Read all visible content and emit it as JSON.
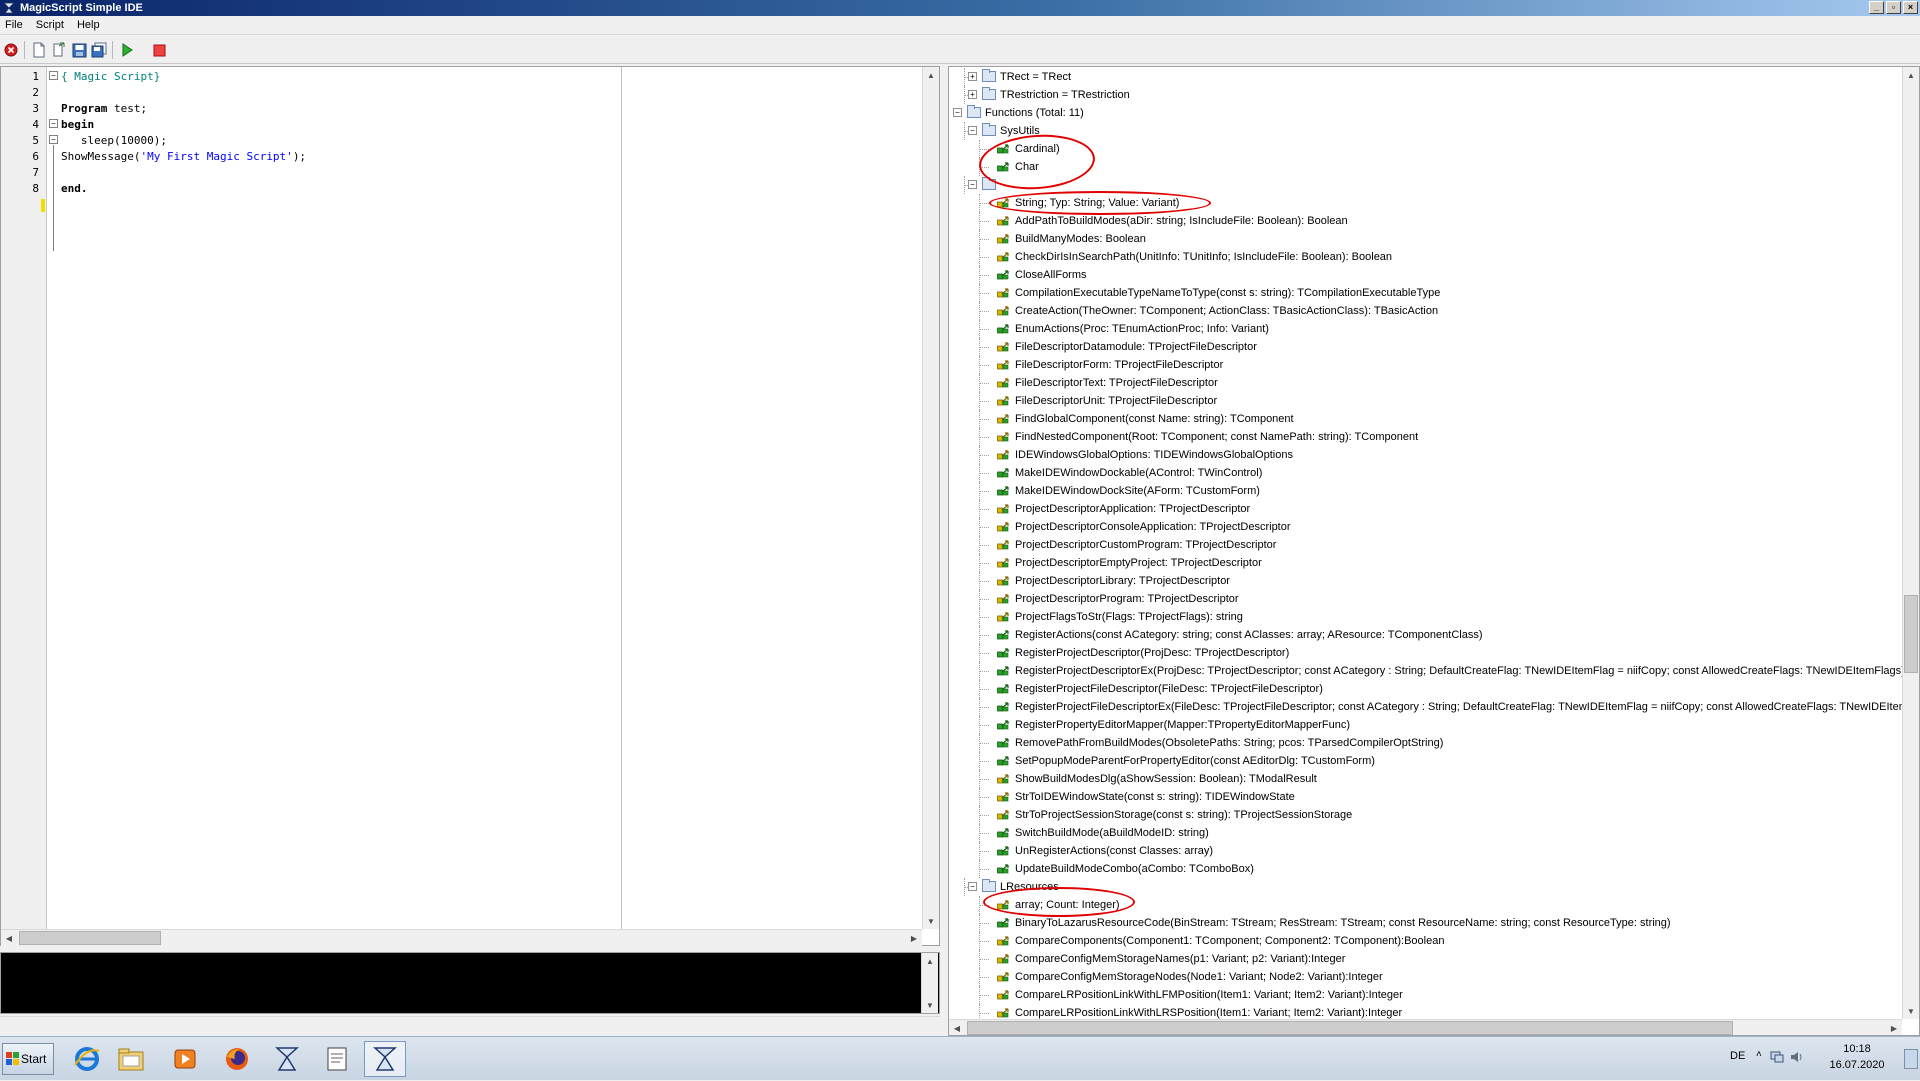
{
  "window": {
    "title": "MagicScript Simple IDE"
  },
  "menu": [
    "File",
    "Script",
    "Help"
  ],
  "toolbar": {
    "icons": [
      "stop-circle-icon",
      "new-file-icon",
      "open-file-icon",
      "save-icon",
      "save-all-icon",
      "run-icon",
      "stop-icon"
    ]
  },
  "editor": {
    "line_numbers": [
      "1",
      "2",
      "3",
      "4",
      "5",
      "6",
      "7",
      "8"
    ],
    "lines": [
      {
        "parts": [
          {
            "t": "{ Magic Script}",
            "c": "cm"
          }
        ]
      },
      {
        "parts": []
      },
      {
        "parts": [
          {
            "t": "Program",
            "c": "kw"
          },
          {
            "t": " test;",
            "c": ""
          }
        ]
      },
      {
        "parts": [
          {
            "t": "begin",
            "c": "kw"
          }
        ]
      },
      {
        "parts": [
          {
            "t": "   sleep(10000);",
            "c": ""
          }
        ]
      },
      {
        "parts": [
          {
            "t": "ShowMessage(",
            "c": ""
          },
          {
            "t": "'My First Magic Script'",
            "c": "str"
          },
          {
            "t": ");",
            "c": ""
          }
        ]
      },
      {
        "parts": []
      },
      {
        "parts": [
          {
            "t": "end.",
            "c": "kw"
          }
        ]
      }
    ]
  },
  "tree": {
    "rows": [
      {
        "level": 1,
        "exp": "+",
        "icon": "folder",
        "text": "TRect = TRect"
      },
      {
        "level": 1,
        "exp": "+",
        "icon": "folder",
        "text": "TRestriction = TRestriction"
      },
      {
        "level": 0,
        "exp": "-",
        "icon": "folder",
        "text": "Functions (Total: 11)"
      },
      {
        "level": 1,
        "exp": "-",
        "icon": "folder",
        "text": "SysUtils"
      },
      {
        "level": 2,
        "icon": "green",
        "text": "Cardinal)"
      },
      {
        "level": 2,
        "icon": "green",
        "text": "Char"
      },
      {
        "level": 1,
        "exp": "-",
        "icon": "folder",
        "text": ""
      },
      {
        "level": 2,
        "icon": "yellow",
        "text": "String; Typ: String; Value: Variant)"
      },
      {
        "level": 2,
        "icon": "yellow",
        "text": "AddPathToBuildModes(aDir: string; IsIncludeFile: Boolean): Boolean"
      },
      {
        "level": 2,
        "icon": "yellow",
        "text": "BuildManyModes: Boolean"
      },
      {
        "level": 2,
        "icon": "yellow",
        "text": "CheckDirIsInSearchPath(UnitInfo: TUnitInfo; IsIncludeFile: Boolean): Boolean"
      },
      {
        "level": 2,
        "icon": "green",
        "text": "CloseAllForms"
      },
      {
        "level": 2,
        "icon": "yellow",
        "text": "CompilationExecutableTypeNameToType(const s: string): TCompilationExecutableType"
      },
      {
        "level": 2,
        "icon": "yellow",
        "text": "CreateAction(TheOwner: TComponent; ActionClass: TBasicActionClass): TBasicAction"
      },
      {
        "level": 2,
        "icon": "green",
        "text": "EnumActions(Proc: TEnumActionProc; Info: Variant)"
      },
      {
        "level": 2,
        "icon": "yellow",
        "text": "FileDescriptorDatamodule: TProjectFileDescriptor"
      },
      {
        "level": 2,
        "icon": "yellow",
        "text": "FileDescriptorForm: TProjectFileDescriptor"
      },
      {
        "level": 2,
        "icon": "yellow",
        "text": "FileDescriptorText: TProjectFileDescriptor"
      },
      {
        "level": 2,
        "icon": "yellow",
        "text": "FileDescriptorUnit: TProjectFileDescriptor"
      },
      {
        "level": 2,
        "icon": "yellow",
        "text": "FindGlobalComponent(const Name: string): TComponent"
      },
      {
        "level": 2,
        "icon": "yellow",
        "text": "FindNestedComponent(Root: TComponent; const NamePath: string): TComponent"
      },
      {
        "level": 2,
        "icon": "yellow",
        "text": "IDEWindowsGlobalOptions: TIDEWindowsGlobalOptions"
      },
      {
        "level": 2,
        "icon": "green",
        "text": "MakeIDEWindowDockable(AControl: TWinControl)"
      },
      {
        "level": 2,
        "icon": "green",
        "text": "MakeIDEWindowDockSite(AForm: TCustomForm)"
      },
      {
        "level": 2,
        "icon": "yellow",
        "text": "ProjectDescriptorApplication: TProjectDescriptor"
      },
      {
        "level": 2,
        "icon": "yellow",
        "text": "ProjectDescriptorConsoleApplication: TProjectDescriptor"
      },
      {
        "level": 2,
        "icon": "yellow",
        "text": "ProjectDescriptorCustomProgram: TProjectDescriptor"
      },
      {
        "level": 2,
        "icon": "yellow",
        "text": "ProjectDescriptorEmptyProject: TProjectDescriptor"
      },
      {
        "level": 2,
        "icon": "yellow",
        "text": "ProjectDescriptorLibrary: TProjectDescriptor"
      },
      {
        "level": 2,
        "icon": "yellow",
        "text": "ProjectDescriptorProgram: TProjectDescriptor"
      },
      {
        "level": 2,
        "icon": "yellow",
        "text": "ProjectFlagsToStr(Flags: TProjectFlags): string"
      },
      {
        "level": 2,
        "icon": "green",
        "text": "RegisterActions(const ACategory: string; const AClasses: array; AResource: TComponentClass)"
      },
      {
        "level": 2,
        "icon": "green",
        "text": "RegisterProjectDescriptor(ProjDesc: TProjectDescriptor)"
      },
      {
        "level": 2,
        "icon": "green",
        "text": "RegisterProjectDescriptorEx(ProjDesc: TProjectDescriptor; const ACategory : String; DefaultCreateFlag: TNewIDEItemFlag = niifCopy; const AllowedCreateFlags: TNewIDEItemFlags)"
      },
      {
        "level": 2,
        "icon": "green",
        "text": "RegisterProjectFileDescriptor(FileDesc: TProjectFileDescriptor)"
      },
      {
        "level": 2,
        "icon": "green",
        "text": "RegisterProjectFileDescriptorEx(FileDesc: TProjectFileDescriptor; const ACategory : String; DefaultCreateFlag: TNewIDEItemFlag = niifCopy; const AllowedCreateFlags: TNewIDEItemFla"
      },
      {
        "level": 2,
        "icon": "green",
        "text": "RegisterPropertyEditorMapper(Mapper:TPropertyEditorMapperFunc)"
      },
      {
        "level": 2,
        "icon": "green",
        "text": "RemovePathFromBuildModes(ObsoletePaths: String; pcos: TParsedCompilerOptString)"
      },
      {
        "level": 2,
        "icon": "green",
        "text": "SetPopupModeParentForPropertyEditor(const AEditorDlg: TCustomForm)"
      },
      {
        "level": 2,
        "icon": "yellow",
        "text": "ShowBuildModesDlg(aShowSession: Boolean): TModalResult"
      },
      {
        "level": 2,
        "icon": "yellow",
        "text": "StrToIDEWindowState(const s: string): TIDEWindowState"
      },
      {
        "level": 2,
        "icon": "yellow",
        "text": "StrToProjectSessionStorage(const s: string): TProjectSessionStorage"
      },
      {
        "level": 2,
        "icon": "green",
        "text": "SwitchBuildMode(aBuildModeID: string)"
      },
      {
        "level": 2,
        "icon": "green",
        "text": "UnRegisterActions(const Classes: array)"
      },
      {
        "level": 2,
        "icon": "green",
        "text": "UpdateBuildModeCombo(aCombo: TComboBox)"
      },
      {
        "level": 1,
        "exp": "-",
        "icon": "folder",
        "text": "LResources"
      },
      {
        "level": 2,
        "icon": "yellow",
        "text": "array; Count: Integer)"
      },
      {
        "level": 2,
        "icon": "green",
        "text": "BinaryToLazarusResourceCode(BinStream: TStream; ResStream: TStream; const ResourceName: string; const ResourceType: string)"
      },
      {
        "level": 2,
        "icon": "yellow",
        "text": "CompareComponents(Component1: TComponent; Component2: TComponent):Boolean"
      },
      {
        "level": 2,
        "icon": "yellow",
        "text": "CompareConfigMemStorageNames(p1: Variant; p2: Variant):Integer"
      },
      {
        "level": 2,
        "icon": "yellow",
        "text": "CompareConfigMemStorageNodes(Node1: Variant; Node2: Variant):Integer"
      },
      {
        "level": 2,
        "icon": "yellow",
        "text": "CompareLRPositionLinkWithLFMPosition(Item1: Variant; Item2: Variant):Integer"
      },
      {
        "level": 2,
        "icon": "yellow",
        "text": "CompareLRPositionLinkWithLRSPosition(Item1: Variant; Item2: Variant):Integer"
      }
    ]
  },
  "taskbar": {
    "start_label": "Start",
    "apps": [
      "internet-explorer-icon",
      "file-explorer-icon",
      "media-player-icon",
      "firefox-icon",
      "magicscript-icon",
      "notepad-icon",
      "magicscript-active-icon"
    ],
    "language": "DE",
    "time": "10:18",
    "date": "16.07.2020"
  },
  "colors": {
    "annotation": "#e00000",
    "keyword": "#000000",
    "comment": "#008080",
    "string": "#0000ff"
  }
}
